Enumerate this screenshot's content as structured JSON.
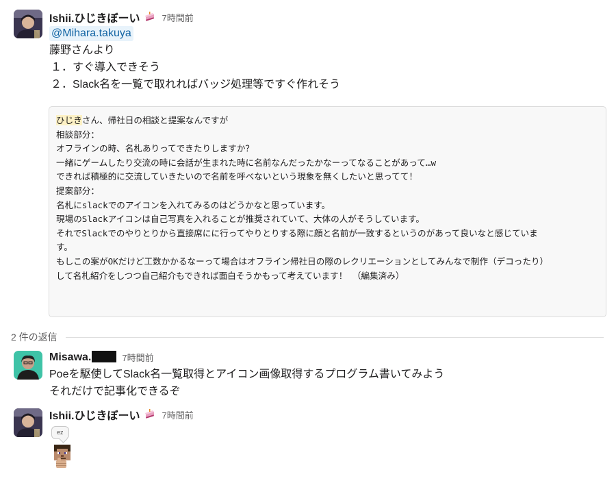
{
  "messages": [
    {
      "author": "Ishii.ひじきぼーい",
      "time": "7時間前",
      "status_icon": "cake-icon",
      "mention": "@Mihara.takuya",
      "lines": [
        "藤野さんより",
        "１．すぐ導入できそう",
        "２．Slack名を一覧で取れればバッジ処理等ですぐ作れそう"
      ],
      "quote": {
        "highlight": "ひじき",
        "first_line_rest": "さん、帰社日の相談と提案なんですが",
        "lines": [
          "相談部分：",
          "オフラインの時、名札ありってできたりしますか？",
          "一緒にゲームしたり交流の時に会話が生まれた時に名前なんだったかなーってなることがあって…w",
          "できれば積極的に交流していきたいので名前を呼べないという現象を無くしたいと思ってて！",
          "",
          "提案部分：",
          "名札にslackでのアイコンを入れてみるのはどうかなと思っています。",
          "",
          "現場のSlackアイコンは自己写真を入れることが推奨されていて、大体の人がそうしています。",
          "それでSlackでのやりとりから直接席にに行ってやりとりする際に顔と名前が一致するというのがあって良いなと感じていま",
          "す。",
          "もしこの案がOKだけど工数かかるなーって場合はオフライン帰社日の際のレクリエーションとしてみんなで制作（デコったり）",
          "して名札紹介をしつつ自己紹介もできれば面白そうかもって考えています！ （編集済み）"
        ]
      }
    },
    {
      "replies_label": "2 件の返信"
    },
    {
      "author": "Misawa.",
      "time": "7時間前",
      "lines": [
        "Poeを駆使してSlack名一覧取得とアイコン画像取得するプログラム書いてみよう",
        "それだけで記事化できるぞ"
      ]
    },
    {
      "author": "Ishii.ひじきぼーい",
      "time": "7時間前",
      "status_icon": "cake-icon",
      "bubble_text": "ez",
      "emoji": "blocky-character-thumbs-up-emoji"
    }
  ]
}
